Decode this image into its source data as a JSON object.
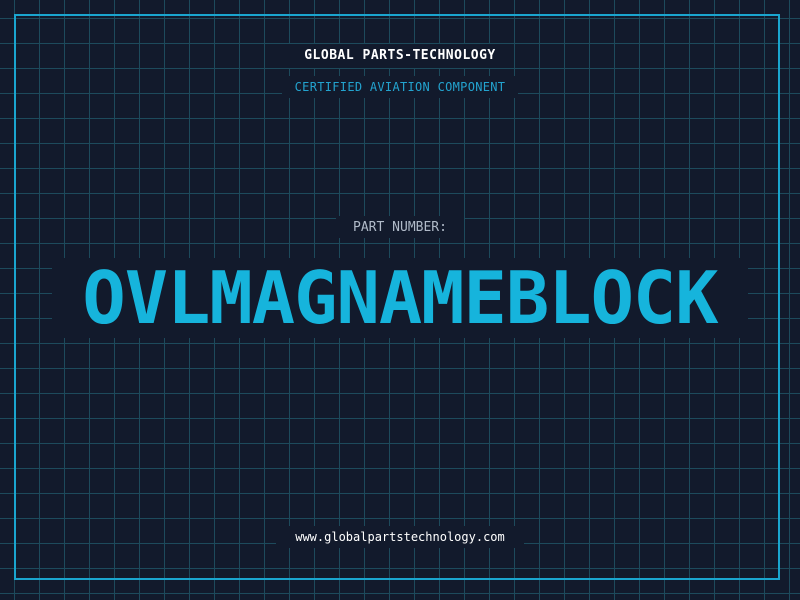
{
  "header": {
    "brand": "GLOBAL PARTS-TECHNOLOGY",
    "subtitle": "CERTIFIED AVIATION COMPONENT"
  },
  "main": {
    "label": "PART NUMBER:",
    "part_number": "OVLMAGNAMEBLOCK"
  },
  "footer": {
    "url": "www.globalpartstechnology.com"
  },
  "colors": {
    "background": "#121a2c",
    "grid": "#1d4a5c",
    "accent": "#16b4dc",
    "frame": "#1aa5cf"
  }
}
